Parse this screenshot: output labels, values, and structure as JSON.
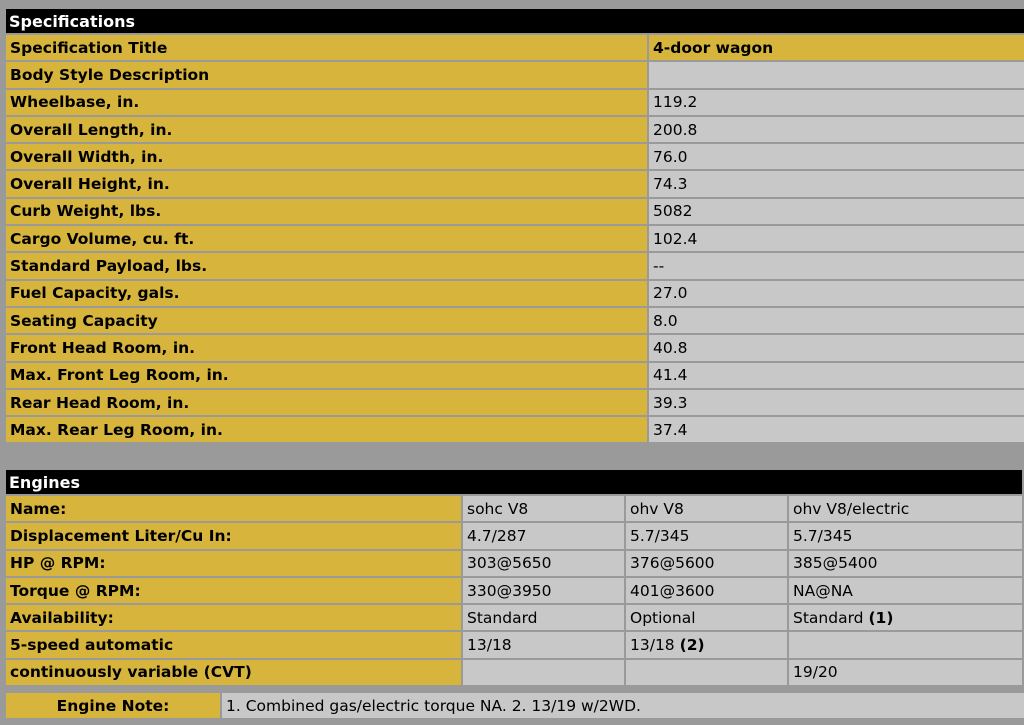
{
  "specs": {
    "header": "Specifications",
    "title_label": "Specification Title",
    "title_value": "4-door wagon",
    "rows": [
      {
        "label": "Body Style Description",
        "value": ""
      },
      {
        "label": "Wheelbase, in.",
        "value": "119.2"
      },
      {
        "label": "Overall Length, in.",
        "value": "200.8"
      },
      {
        "label": "Overall Width, in.",
        "value": "76.0"
      },
      {
        "label": "Overall Height, in.",
        "value": "74.3"
      },
      {
        "label": "Curb Weight, lbs.",
        "value": "5082"
      },
      {
        "label": "Cargo Volume, cu. ft.",
        "value": "102.4"
      },
      {
        "label": "Standard Payload, lbs.",
        "value": "--"
      },
      {
        "label": "Fuel Capacity, gals.",
        "value": "27.0"
      },
      {
        "label": "Seating Capacity",
        "value": "8.0"
      },
      {
        "label": "Front Head Room, in.",
        "value": "40.8"
      },
      {
        "label": "Max. Front Leg Room, in.",
        "value": "41.4"
      },
      {
        "label": "Rear Head Room, in.",
        "value": "39.3"
      },
      {
        "label": "Max. Rear Leg Room, in.",
        "value": "37.4"
      }
    ]
  },
  "engines": {
    "header": "Engines",
    "rows": [
      {
        "label": "Name:",
        "cells": [
          {
            "text": "sohc V8"
          },
          {
            "text": "ohv V8"
          },
          {
            "text": "ohv V8/electric"
          }
        ]
      },
      {
        "label": "Displacement Liter/Cu In:",
        "cells": [
          {
            "text": "4.7/287"
          },
          {
            "text": "5.7/345"
          },
          {
            "text": "5.7/345"
          }
        ]
      },
      {
        "label": "HP @ RPM:",
        "cells": [
          {
            "text": "303@5650"
          },
          {
            "text": "376@5600"
          },
          {
            "text": "385@5400"
          }
        ]
      },
      {
        "label": "Torque @ RPM:",
        "cells": [
          {
            "text": "330@3950"
          },
          {
            "text": "401@3600"
          },
          {
            "text": "NA@NA"
          }
        ]
      },
      {
        "label": "Availability:",
        "cells": [
          {
            "text": "Standard"
          },
          {
            "text": "Optional"
          },
          {
            "text": "Standard",
            "note": "(1)"
          }
        ]
      },
      {
        "label": "5-speed automatic",
        "cells": [
          {
            "text": "13/18"
          },
          {
            "text": "13/18",
            "note": "(2)"
          },
          {
            "text": ""
          }
        ]
      },
      {
        "label": "continuously variable (CVT)",
        "cells": [
          {
            "text": ""
          },
          {
            "text": ""
          },
          {
            "text": "19/20"
          }
        ]
      }
    ]
  },
  "engine_note": {
    "label": "Engine Note:",
    "text": "1. Combined gas/electric torque NA. 2. 13/19 w/2WD."
  }
}
